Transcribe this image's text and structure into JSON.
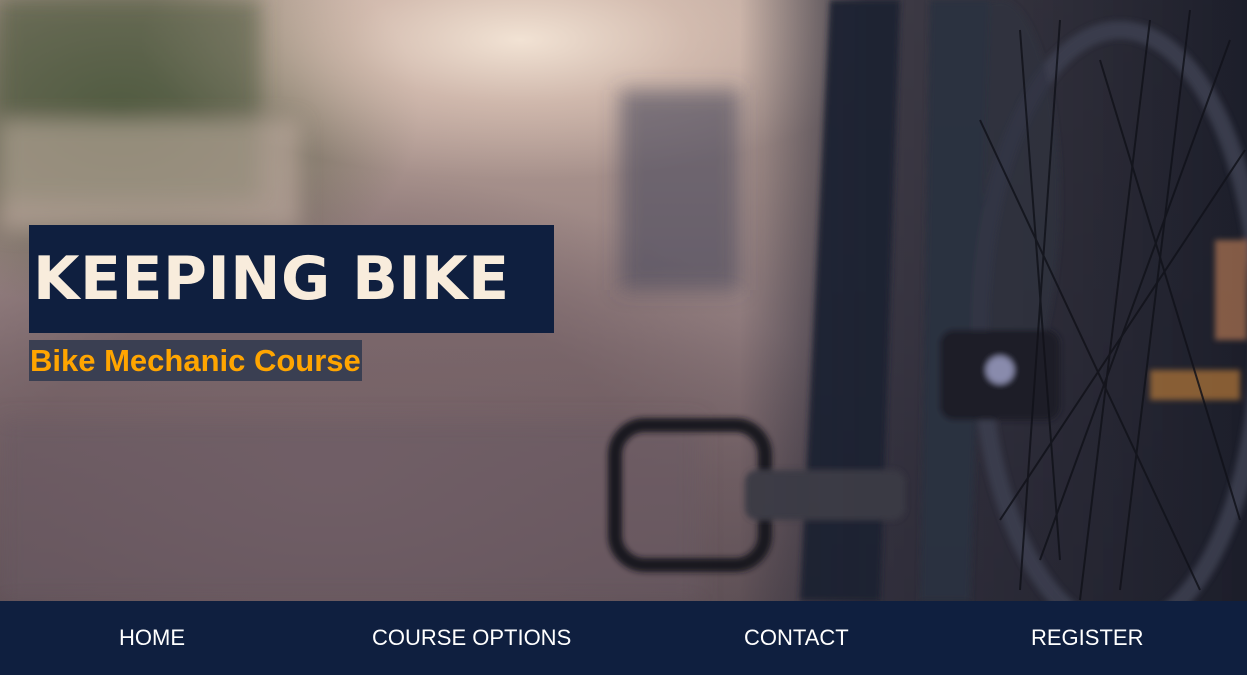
{
  "hero": {
    "title": "KEEPING BIKE",
    "subtitle": "Bike Mechanic Course",
    "image_description_icon": "bicycle-photo"
  },
  "nav": {
    "items": [
      {
        "label": "HOME"
      },
      {
        "label": "COURSE OPTIONS"
      },
      {
        "label": "CONTACT"
      },
      {
        "label": "REGISTER"
      }
    ]
  },
  "colors": {
    "navy": "#0f1f3f",
    "title_text": "#f8ecdc",
    "subtitle_text": "#ffa500",
    "subtitle_bg": "#3a3f52"
  }
}
